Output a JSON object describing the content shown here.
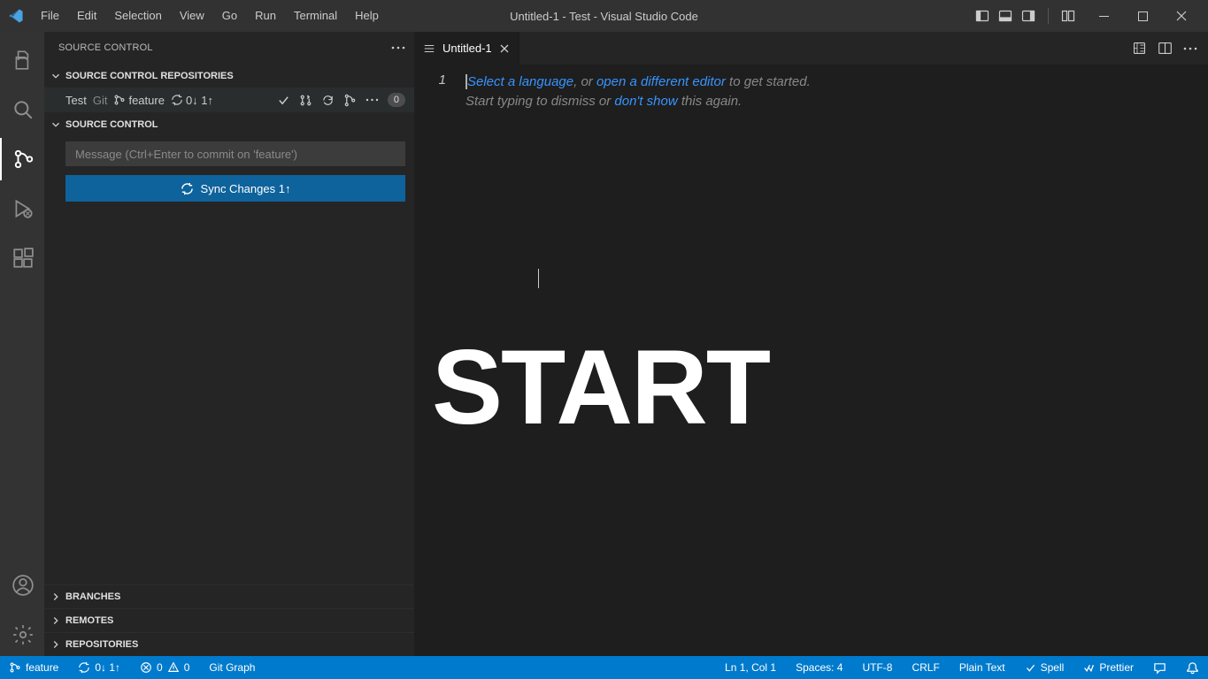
{
  "title": "Untitled-1 - Test - Visual Studio Code",
  "menu": [
    "File",
    "Edit",
    "Selection",
    "View",
    "Go",
    "Run",
    "Terminal",
    "Help"
  ],
  "sidebar": {
    "title": "SOURCE CONTROL",
    "repos_head": "SOURCE CONTROL REPOSITORIES",
    "sc_head": "SOURCE CONTROL",
    "repo": {
      "name": "Test",
      "vcs": "Git",
      "branch": "feature",
      "sync": "0↓ 1↑",
      "badge": "0"
    },
    "message_placeholder": "Message (Ctrl+Enter to commit on 'feature')",
    "sync_button": "Sync Changes 1↑",
    "bottom": [
      "BRANCHES",
      "REMOTES",
      "REPOSITORIES"
    ]
  },
  "tab": {
    "name": "Untitled-1"
  },
  "editor": {
    "line": "1",
    "l1a": "Select a language",
    "l1b": ", or ",
    "l1c": "open a different editor",
    "l1d": " to get started.",
    "l2a": "Start typing to dismiss or ",
    "l2b": "don't show",
    "l2c": " this again."
  },
  "overlay": "START",
  "status": {
    "branch": "feature",
    "sync": "0↓ 1↑",
    "errors": "0",
    "warnings": "0",
    "gitgraph": "Git Graph",
    "pos": "Ln 1, Col 1",
    "spaces": "Spaces: 4",
    "enc": "UTF-8",
    "eol": "CRLF",
    "lang": "Plain Text",
    "spell": "Spell",
    "prettier": "Prettier"
  }
}
